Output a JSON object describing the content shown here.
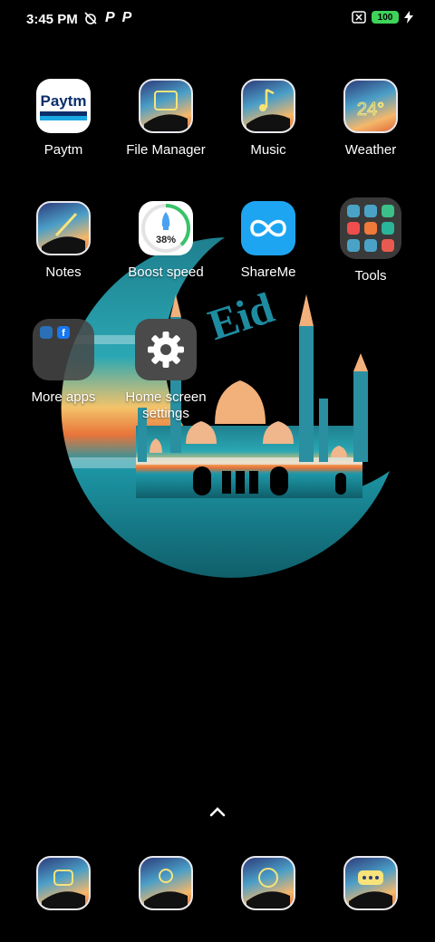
{
  "status_bar": {
    "time": "3:45 PM",
    "battery_level": "100",
    "icons": [
      "alarm-off-icon",
      "p-app-icon",
      "p-app-icon",
      "sim-off-icon",
      "battery-icon",
      "charging-icon"
    ]
  },
  "wallpaper": {
    "caption": "Eid"
  },
  "apps": {
    "paytm": {
      "label": "Paytm",
      "logo": "Paytm"
    },
    "file_manager": {
      "label": "File Manager"
    },
    "music": {
      "label": "Music"
    },
    "weather": {
      "label": "Weather",
      "temp": "24°"
    },
    "notes": {
      "label": "Notes"
    },
    "boost_speed": {
      "label": "Boost speed",
      "percent": "38%",
      "progress": 0.38
    },
    "shareme": {
      "label": "ShareMe"
    },
    "tools": {
      "label": "Tools"
    },
    "more_apps": {
      "label": "More apps"
    },
    "home_settings": {
      "label": "Home screen settings"
    }
  },
  "dock": [
    "phone-icon",
    "camera-icon",
    "browser-icon",
    "messaging-icon"
  ],
  "app_drawer_label": "chevron-up-icon"
}
